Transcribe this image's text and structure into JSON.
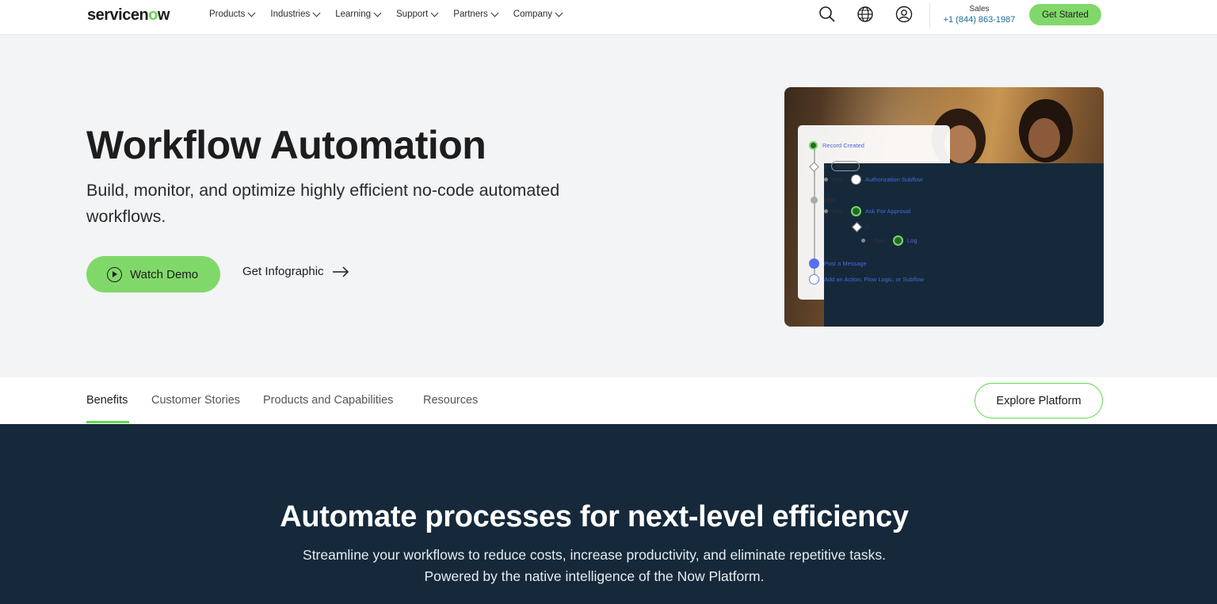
{
  "brand": {
    "logo_text_a": "servicen",
    "logo_text_o": "o",
    "logo_text_b": "w"
  },
  "nav": {
    "items": [
      {
        "label": "Products"
      },
      {
        "label": "Industries"
      },
      {
        "label": "Learning"
      },
      {
        "label": "Support"
      },
      {
        "label": "Partners"
      },
      {
        "label": "Company"
      }
    ],
    "icons": [
      "search-icon",
      "globe-icon",
      "user-icon"
    ],
    "sales_label": "Sales",
    "sales_phone": "+1 (844) 863-1987",
    "cta_label": "Get Started"
  },
  "hero": {
    "title": "Workflow Automation",
    "subtitle": "Build, monitor, and optimize highly efficient no-code automated workflows.",
    "primary_button": "Watch Demo",
    "secondary_link": "Get Infographic",
    "flow_card": {
      "record_created": "Record Created",
      "if": "If",
      "record": "Record",
      "then1": "then",
      "authorization": "Authorization Subflow",
      "else": "Else",
      "then2": "then",
      "ask_approval": "Ask For Approval",
      "if2": "If",
      "then3": "then",
      "log": "Log",
      "post_message": "Post a Message",
      "add_action": "Add an Action, Flow Logic, or Subflow"
    }
  },
  "subnav": {
    "tabs": [
      {
        "label": "Benefits"
      },
      {
        "label": "Customer Stories"
      },
      {
        "label": "Products and Capabilities"
      },
      {
        "label": "Resources"
      }
    ],
    "active_tab": "Benefits",
    "cta_label": "Explore Platform"
  },
  "section": {
    "title": "Automate processes for next-level efficiency",
    "line1": "Streamline your workflows to reduce costs, increase productivity, and eliminate repetitive tasks.",
    "line2": "Powered by the native intelligence of the Now Platform."
  },
  "colors": {
    "accent_green": "#81d86a",
    "dark_navy": "#15293b",
    "hero_bg": "#f3f4f6",
    "phone_blue": "#1a6a8f"
  }
}
